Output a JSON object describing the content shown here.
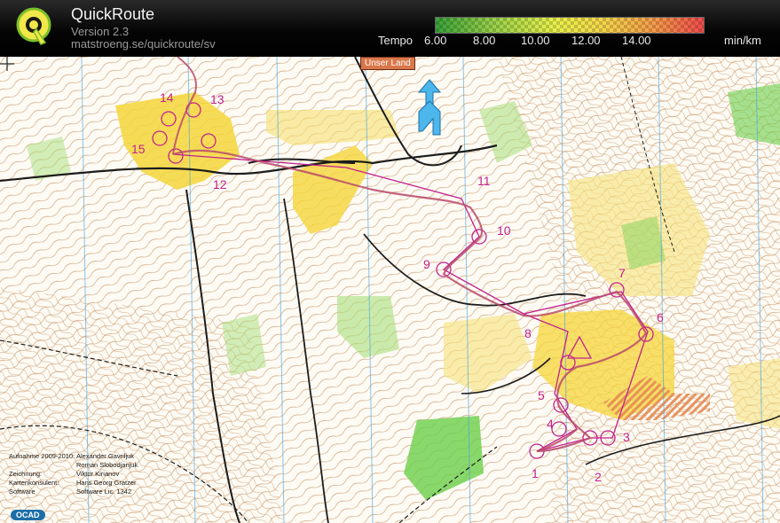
{
  "app": {
    "title": "QuickRoute",
    "version": "Version 2.3",
    "url": "matstroeng.se/quickroute/sv"
  },
  "pace_legend": {
    "label": "Tempo",
    "ticks": [
      "6.00",
      "8.00",
      "10.00",
      "12.00",
      "14.00"
    ],
    "unit": "min/km",
    "colors": [
      "#3aa23a",
      "#9bd14a",
      "#e9f04a",
      "#f4d64a",
      "#f49a4a",
      "#f24a4a"
    ]
  },
  "map": {
    "sign": "Unser Land",
    "controls": [
      "1",
      "2",
      "3",
      "4",
      "5",
      "6",
      "7",
      "8",
      "9",
      "10",
      "11",
      "12",
      "13",
      "14",
      "15"
    ],
    "credits": [
      {
        "key": "Aufnahme 2009-2010:",
        "value": "Alexander Gavriljuk"
      },
      {
        "key": "",
        "value": "Roman Slobodjanjuk"
      },
      {
        "key": "Zeichnung:",
        "value": "Viktor Kirianov"
      },
      {
        "key": "Kartenkonsulent:",
        "value": "Hans Georg Gratzer"
      },
      {
        "key": "Software",
        "value": "Software  Lic. 1342"
      }
    ],
    "logo_text": "OCAD",
    "route_color": "#c2218f",
    "contour_color": "#b5703c",
    "open_land_color": "#f5d63a",
    "forest_green": "#6ccf4a"
  }
}
